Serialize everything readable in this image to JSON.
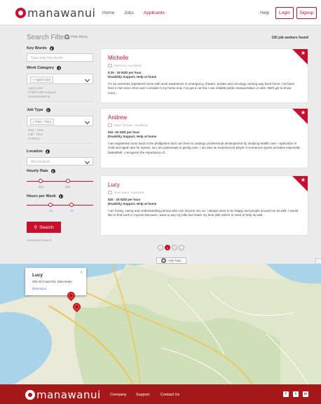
{
  "nav": {
    "logo_text": "manawanui",
    "links": [
      "Home",
      "Jobs",
      "Applicants"
    ],
    "help": "Help",
    "login": "Login",
    "signup": "Signup"
  },
  "filters": {
    "title": "Search Filters",
    "hide_menu": "Hide Menu",
    "found": "150 job seekers found",
    "keywords_label": "Key Words",
    "keywords_placeholder": "Type your key words",
    "work_category_label": "Work Category",
    "work_category_chip": "× Aged Care",
    "work_category_options": [
      "Aged Care",
      "Child/Youth Support",
      "Companionship"
    ],
    "job_type_label": "Job Type",
    "job_type_chip": "× Part - Time",
    "job_type_options": [
      "Part - Time",
      "Full - Time",
      "Contract"
    ],
    "location_label": "Location",
    "location_placeholder": "Any location",
    "hourly_rate_label": "Hourly Rate",
    "hourly_rate_min": "$15",
    "hourly_rate_max": "$25",
    "hours_label": "Hours per Week",
    "hours_min": "15",
    "hours_max": "30",
    "search_label": "Search",
    "advanced": "Advanced Search"
  },
  "results": [
    {
      "name": "Michelle",
      "location": "Balmoral, Auckland",
      "rate": "$ 20 - 25 NZD per hour",
      "categories": "Disability Support, Help at home",
      "description": "I'm an overseas registered nurse with work experience in emergency, theatre, private and oncology nursing way back home. I've been here in NZ since 2011 and I consider it my home now. I've got a car but I use reliable public transportation or uber. We'll get to know more..."
    },
    {
      "name": "Andrew",
      "location": "Eden Terrace, Auckland",
      "rate": "$16 -20 NZD per hour",
      "categories": "Disability Support, Help at home",
      "description": "I am registered nurse back in the philippines and I am here to undergo professional development by studying health care. I specialize in child and aged care for 5years. as I am passionate in giving care. I am also an experienced player in numerous sports activities especially basketball. I recognize the importance of..."
    },
    {
      "name": "Lucy",
      "location": "Glen Eden, Auckland",
      "rate": "$20 - 25 NZD per hour",
      "categories": "Disability Support, Help at home",
      "description": "I am loving, caring and understanding person who can anyone rely on. I always want to be happy and people around me as well. I would like to find work in mycare because I want to pay my bills and share my time with others in need of help as well..."
    }
  ],
  "pagination": {
    "pages": [
      "‹",
      "1",
      "2",
      "›"
    ],
    "active": "1",
    "hide_map": "Hide Map"
  },
  "map": {
    "popup_name": "Lucy",
    "popup_address": "292 W Coast Rd, Glen Eden",
    "popup_directions": "Directions",
    "popup_close": "×"
  },
  "footer": {
    "logo_text": "manawanui",
    "links": [
      "Company",
      "Support",
      "Contact Us"
    ],
    "social": [
      "f",
      "t",
      "in"
    ]
  },
  "colors": {
    "brand": "#c8102e",
    "footer": "#a5191b"
  }
}
